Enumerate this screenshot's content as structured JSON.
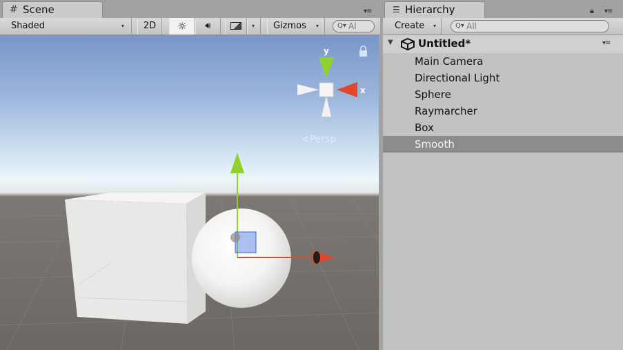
{
  "scene_tab": {
    "title": "Scene",
    "toolbar": {
      "shading_mode": "Shaded",
      "mode_2d": "2D",
      "gizmos_label": "Gizmos",
      "search_placeholder": "Al"
    },
    "viewport": {
      "projection_label": "Persp",
      "axis_y": "y",
      "axis_x": "x"
    }
  },
  "hierarchy_tab": {
    "title": "Hierarchy",
    "create_label": "Create",
    "search_placeholder": "All",
    "scene_name": "Untitled*",
    "items": [
      {
        "label": "Main Camera",
        "selected": false
      },
      {
        "label": "Directional Light",
        "selected": false
      },
      {
        "label": "Sphere",
        "selected": false
      },
      {
        "label": "Raymarcher",
        "selected": false
      },
      {
        "label": "Box",
        "selected": false
      },
      {
        "label": "Smooth",
        "selected": true
      }
    ]
  },
  "colors": {
    "selection": "#8c8c8c",
    "axis_x": "#e2462b",
    "axis_y": "#8fd22d",
    "panel_bg": "#c2c2c2"
  }
}
